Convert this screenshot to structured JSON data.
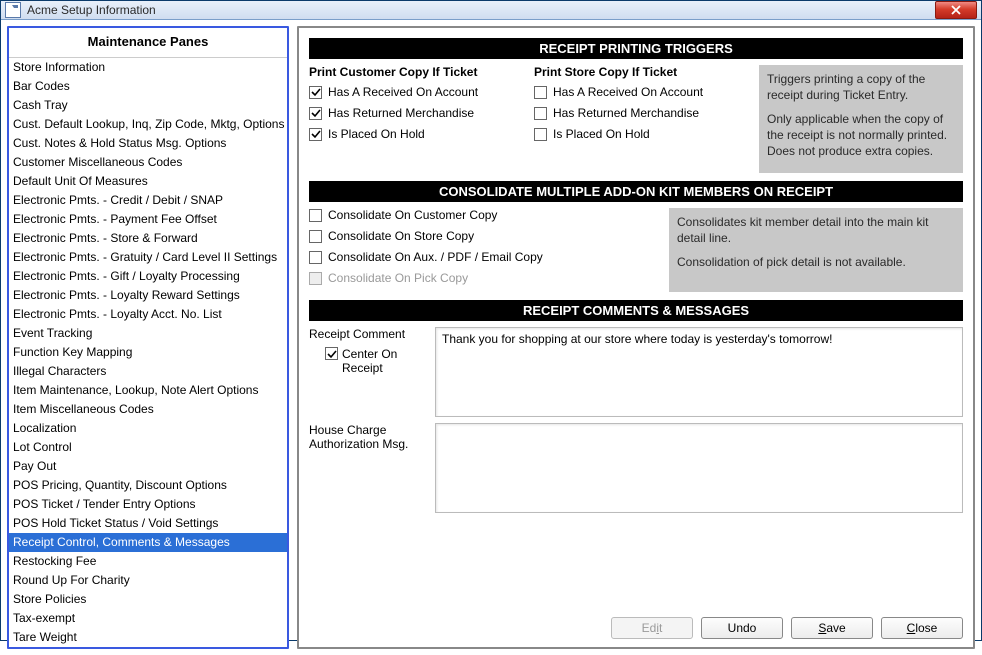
{
  "window": {
    "title": "Acme Setup Information"
  },
  "sidebar": {
    "header": "Maintenance Panes",
    "items": [
      "Store Information",
      "Bar Codes",
      "Cash Tray",
      "Cust. Default Lookup, Inq, Zip Code, Mktg, Options",
      "Cust. Notes & Hold Status Msg. Options",
      "Customer Miscellaneous Codes",
      "Default Unit Of Measures",
      "Electronic Pmts. - Credit / Debit / SNAP",
      "Electronic Pmts. - Payment Fee Offset",
      "Electronic Pmts. - Store & Forward",
      "Electronic Pmts. - Gratuity / Card Level II Settings",
      "Electronic Pmts. - Gift / Loyalty Processing",
      "Electronic Pmts. - Loyalty Reward Settings",
      "Electronic Pmts. - Loyalty Acct. No. List",
      "Event Tracking",
      "Function Key Mapping",
      "Illegal Characters",
      "Item Maintenance, Lookup, Note Alert Options",
      "Item Miscellaneous Codes",
      "Localization",
      "Lot Control",
      "Pay Out",
      "POS Pricing, Quantity, Discount Options",
      "POS Ticket / Tender Entry Options",
      "POS Hold Ticket Status / Void Settings",
      "Receipt Control, Comments & Messages",
      "Restocking Fee",
      "Round Up For Charity",
      "Store Policies",
      "Tax-exempt",
      "Tare Weight"
    ],
    "selected_index": 25
  },
  "sections": {
    "triggers": {
      "header": "RECEIPT PRINTING TRIGGERS",
      "customer": {
        "title": "Print Customer Copy If Ticket",
        "opts": [
          {
            "label": "Has A Received On Account",
            "checked": true
          },
          {
            "label": "Has Returned Merchandise",
            "checked": true
          },
          {
            "label": "Is Placed On Hold",
            "checked": true
          }
        ]
      },
      "store": {
        "title": "Print Store Copy If Ticket",
        "opts": [
          {
            "label": "Has A Received On Account",
            "checked": false
          },
          {
            "label": "Has Returned Merchandise",
            "checked": false
          },
          {
            "label": "Is Placed On Hold",
            "checked": false
          }
        ]
      },
      "help1": "Triggers printing a copy of the receipt during Ticket Entry.",
      "help2": "Only applicable when the copy of the receipt is not normally printed.  Does not produce extra copies."
    },
    "consolidate": {
      "header": "CONSOLIDATE MULTIPLE ADD-ON KIT MEMBERS ON RECEIPT",
      "opts": [
        {
          "label": "Consolidate On Customer Copy",
          "checked": false,
          "disabled": false
        },
        {
          "label": "Consolidate On Store Copy",
          "checked": false,
          "disabled": false
        },
        {
          "label": "Consolidate On Aux. / PDF / Email Copy",
          "checked": false,
          "disabled": false
        },
        {
          "label": "Consolidate On Pick Copy",
          "checked": false,
          "disabled": true
        }
      ],
      "help1": "Consolidates kit member detail into the main kit detail line.",
      "help2": "Consolidation of pick detail is not available."
    },
    "comments": {
      "header": "RECEIPT COMMENTS & MESSAGES",
      "receipt_label": "Receipt Comment",
      "center_label": "Center On Receipt",
      "center_checked": true,
      "receipt_value": "Thank you for shopping at our store where today is yesterday's tomorrow!",
      "house_label": "House Charge Authorization Msg.",
      "house_value": ""
    }
  },
  "buttons": {
    "edit": "Edit",
    "undo": "Undo",
    "save": "Save",
    "close": "Close"
  }
}
